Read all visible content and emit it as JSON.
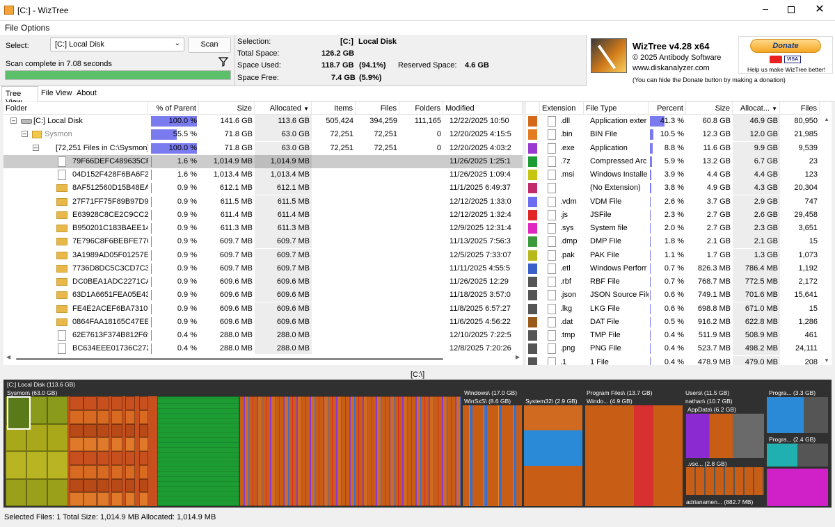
{
  "window": {
    "title": "[C:]  - WizTree"
  },
  "menu": {
    "file": "File",
    "options": "Options"
  },
  "select": {
    "label": "Select:",
    "value": "[C:] Local Disk",
    "scan_label": "Scan",
    "status": "Scan complete in 7.08 seconds",
    "progress": 1.0
  },
  "info": {
    "selection_label": "Selection:",
    "selection_drive": "[C:]",
    "selection_name": "Local Disk",
    "total_label": "Total Space:",
    "total_value": "126.2 GB",
    "used_label": "Space Used:",
    "used_value": "118.7 GB",
    "used_pct": "(94.1%)",
    "reserved_label": "Reserved Space:",
    "reserved_value": "4.6 GB",
    "free_label": "Space Free:",
    "free_value": "7.4 GB",
    "free_pct": "(5.9%)"
  },
  "about": {
    "title": "WizTree v4.28 x64",
    "copyright": "© 2025 Antibody Software",
    "site": "www.diskanalyzer.com",
    "note": "(You can hide the Donate button by making a donation)",
    "donate": "Donate",
    "help": "Help us make WizTree better!",
    "cards": "VISA"
  },
  "tabs": {
    "tree": "Tree View",
    "file": "File View",
    "about": "About"
  },
  "tree_headers": {
    "folder": "Folder",
    "pct": "% of Parent",
    "size": "Size",
    "alloc": "Allocated",
    "items": "Items",
    "files": "Files",
    "folders": "Folders",
    "modified": "Modified"
  },
  "tree_rows": [
    {
      "name": "[C:] Local Disk",
      "pct": "100.0 %",
      "pctv": 1.0,
      "size": "141.6 GB",
      "alloc": "113.6 GB",
      "items": "505,424",
      "files": "394,259",
      "folders": "111,165",
      "modified": "12/22/2025 10:50"
    },
    {
      "name": "Sysmon",
      "pct": "55.5 %",
      "pctv": 0.555,
      "size": "71.8 GB",
      "alloc": "63.0 GB",
      "items": "72,251",
      "files": "72,251",
      "folders": "0",
      "modified": "12/20/2025 4:15:5"
    },
    {
      "name": "[72,251 Files in C:\\Sysmon]",
      "pct": "100.0 %",
      "pctv": 1.0,
      "size": "71.8 GB",
      "alloc": "63.0 GB",
      "items": "72,251",
      "files": "72,251",
      "folders": "0",
      "modified": "12/20/2025 4:03:2"
    },
    {
      "name": "79F66DEFC489635CF5",
      "pct": "1.6 %",
      "pctv": 0.016,
      "size": "1,014.9 MB",
      "alloc": "1,014.9 MB",
      "items": "",
      "files": "",
      "folders": "",
      "modified": "11/26/2025 1:25:1"
    },
    {
      "name": "04D152F428F6BA6F23",
      "pct": "1.6 %",
      "pctv": 0.016,
      "size": "1,013.4 MB",
      "alloc": "1,013.4 MB",
      "items": "",
      "files": "",
      "folders": "",
      "modified": "11/26/2025 1:09:4"
    },
    {
      "name": "8AF512560D15B48EA",
      "pct": "0.9 %",
      "pctv": 0.009,
      "size": "612.1 MB",
      "alloc": "612.1 MB",
      "items": "",
      "files": "",
      "folders": "",
      "modified": "11/1/2025 6:49:37"
    },
    {
      "name": "27F71FF75F89B97D97",
      "pct": "0.9 %",
      "pctv": 0.009,
      "size": "611.5 MB",
      "alloc": "611.5 MB",
      "items": "",
      "files": "",
      "folders": "",
      "modified": "12/12/2025 1:33:0"
    },
    {
      "name": "E63928C8CE2C9CC21I",
      "pct": "0.9 %",
      "pctv": 0.009,
      "size": "611.4 MB",
      "alloc": "611.4 MB",
      "items": "",
      "files": "",
      "folders": "",
      "modified": "12/12/2025 1:32:4"
    },
    {
      "name": "B950201C183BAEE147",
      "pct": "0.9 %",
      "pctv": 0.009,
      "size": "611.3 MB",
      "alloc": "611.3 MB",
      "items": "",
      "files": "",
      "folders": "",
      "modified": "12/9/2025 12:31:4"
    },
    {
      "name": "7E796C8F6BEBFE776B",
      "pct": "0.9 %",
      "pctv": 0.009,
      "size": "609.7 MB",
      "alloc": "609.7 MB",
      "items": "",
      "files": "",
      "folders": "",
      "modified": "11/13/2025 7:56:3"
    },
    {
      "name": "3A1989AD05F01257E",
      "pct": "0.9 %",
      "pctv": 0.009,
      "size": "609.7 MB",
      "alloc": "609.7 MB",
      "items": "",
      "files": "",
      "folders": "",
      "modified": "12/5/2025 7:33:07"
    },
    {
      "name": "7736D8DC5C3CD7C3!",
      "pct": "0.9 %",
      "pctv": 0.009,
      "size": "609.7 MB",
      "alloc": "609.7 MB",
      "items": "",
      "files": "",
      "folders": "",
      "modified": "11/11/2025 4:55:5"
    },
    {
      "name": "DC0BEA1ADC2271CA",
      "pct": "0.9 %",
      "pctv": 0.009,
      "size": "609.6 MB",
      "alloc": "609.6 MB",
      "items": "",
      "files": "",
      "folders": "",
      "modified": "11/26/2025 12:29"
    },
    {
      "name": "63D1A6651FEA05E43",
      "pct": "0.9 %",
      "pctv": 0.009,
      "size": "609.6 MB",
      "alloc": "609.6 MB",
      "items": "",
      "files": "",
      "folders": "",
      "modified": "11/18/2025 3:57:0"
    },
    {
      "name": "FE4E2ACEF6BA73109",
      "pct": "0.9 %",
      "pctv": 0.009,
      "size": "609.6 MB",
      "alloc": "609.6 MB",
      "items": "",
      "files": "",
      "folders": "",
      "modified": "11/8/2025 6:57:27"
    },
    {
      "name": "0864FAA18165C47EE",
      "pct": "0.9 %",
      "pctv": 0.009,
      "size": "609.6 MB",
      "alloc": "609.6 MB",
      "items": "",
      "files": "",
      "folders": "",
      "modified": "11/6/2025 4:56:22"
    },
    {
      "name": "62E7613F374B812F69",
      "pct": "0.4 %",
      "pctv": 0.004,
      "size": "288.0 MB",
      "alloc": "288.0 MB",
      "items": "",
      "files": "",
      "folders": "",
      "modified": "12/10/2025 7:22:5"
    },
    {
      "name": "BC634EEE01736C2728",
      "pct": "0.4 %",
      "pctv": 0.004,
      "size": "288.0 MB",
      "alloc": "288.0 MB",
      "items": "",
      "files": "",
      "folders": "",
      "modified": "12/8/2025 7:20:26"
    }
  ],
  "ext_headers": {
    "ext": "Extension",
    "type": "File Type",
    "pct": "Percent",
    "size": "Size",
    "alloc": "Allocat...",
    "files": "Files"
  },
  "ext_rows": [
    {
      "color": "#d4691a",
      "ext": ".dll",
      "type": "Application exter",
      "pct": "41.3 %",
      "pctv": 0.413,
      "size": "60.8 GB",
      "alloc": "46.9 GB",
      "files": "80,950"
    },
    {
      "color": "#e37b22",
      "ext": ".bin",
      "type": "BIN File",
      "pct": "10.5 %",
      "pctv": 0.105,
      "size": "12.3 GB",
      "alloc": "12.0 GB",
      "files": "21,985"
    },
    {
      "color": "#9a39d0",
      "ext": ".exe",
      "type": "Application",
      "pct": "8.8 %",
      "pctv": 0.088,
      "size": "11.6 GB",
      "alloc": "9.9 GB",
      "files": "9,539"
    },
    {
      "color": "#1e9c34",
      "ext": ".7z",
      "type": "Compressed Arc",
      "pct": "5.9 %",
      "pctv": 0.059,
      "size": "13.2 GB",
      "alloc": "6.7 GB",
      "files": "23"
    },
    {
      "color": "#c6c612",
      "ext": ".msi",
      "type": "Windows Installe",
      "pct": "3.9 %",
      "pctv": 0.039,
      "size": "4.4 GB",
      "alloc": "4.4 GB",
      "files": "123"
    },
    {
      "color": "#c22a6a",
      "ext": "",
      "type": "(No Extension)",
      "pct": "3.8 %",
      "pctv": 0.038,
      "size": "4.9 GB",
      "alloc": "4.3 GB",
      "files": "20,304"
    },
    {
      "color": "#6d6df2",
      "ext": ".vdm",
      "type": "VDM File",
      "pct": "2.6 %",
      "pctv": 0.026,
      "size": "3.7 GB",
      "alloc": "2.9 GB",
      "files": "747"
    },
    {
      "color": "#e02626",
      "ext": ".js",
      "type": "JSFile",
      "pct": "2.3 %",
      "pctv": 0.023,
      "size": "2.7 GB",
      "alloc": "2.6 GB",
      "files": "29,458"
    },
    {
      "color": "#e028c0",
      "ext": ".sys",
      "type": "System file",
      "pct": "2.0 %",
      "pctv": 0.02,
      "size": "2.7 GB",
      "alloc": "2.3 GB",
      "files": "3,651"
    },
    {
      "color": "#3c9a3c",
      "ext": ".dmp",
      "type": "DMP File",
      "pct": "1.8 %",
      "pctv": 0.018,
      "size": "2.1 GB",
      "alloc": "2.1 GB",
      "files": "15"
    },
    {
      "color": "#b8b81c",
      "ext": ".pak",
      "type": "PAK File",
      "pct": "1.1 %",
      "pctv": 0.011,
      "size": "1.7 GB",
      "alloc": "1.3 GB",
      "files": "1,073"
    },
    {
      "color": "#3a5fc8",
      "ext": ".etl",
      "type": "Windows Perforr",
      "pct": "0.7 %",
      "pctv": 0.007,
      "size": "826.3 MB",
      "alloc": "786.4 MB",
      "files": "1,192"
    },
    {
      "color": "#555555",
      "ext": ".rbf",
      "type": "RBF File",
      "pct": "0.7 %",
      "pctv": 0.007,
      "size": "768.7 MB",
      "alloc": "772.5 MB",
      "files": "2,172"
    },
    {
      "color": "#555555",
      "ext": ".json",
      "type": "JSON Source File",
      "pct": "0.6 %",
      "pctv": 0.006,
      "size": "749.1 MB",
      "alloc": "701.6 MB",
      "files": "15,641"
    },
    {
      "color": "#555555",
      "ext": ".lkg",
      "type": "LKG File",
      "pct": "0.6 %",
      "pctv": 0.006,
      "size": "698.8 MB",
      "alloc": "671.0 MB",
      "files": "15"
    },
    {
      "color": "#9a5a1a",
      "ext": ".dat",
      "type": "DAT File",
      "pct": "0.5 %",
      "pctv": 0.005,
      "size": "916.2 MB",
      "alloc": "622.8 MB",
      "files": "1,286"
    },
    {
      "color": "#555555",
      "ext": ".tmp",
      "type": "TMP File",
      "pct": "0.4 %",
      "pctv": 0.004,
      "size": "511.9 MB",
      "alloc": "508.9 MB",
      "files": "461"
    },
    {
      "color": "#555555",
      "ext": ".png",
      "type": "PNG File",
      "pct": "0.4 %",
      "pctv": 0.004,
      "size": "523.7 MB",
      "alloc": "498.2 MB",
      "files": "24,111"
    },
    {
      "color": "#555555",
      "ext": ".1",
      "type": "1 File",
      "pct": "0.4 %",
      "pctv": 0.004,
      "size": "478.9 MB",
      "alloc": "479.0 MB",
      "files": "208"
    }
  ],
  "treemap": {
    "path": "[C:\\]",
    "labels": {
      "root": "[C:] Local Disk (113.6 GB)",
      "sysmon": "Sysmon\\ (63.0 GB)",
      "windows": "Windows\\ (17.0 GB)",
      "winsxs": "WinSxS\\ (8.6 GB)",
      "system32": "System32\\ (2.9 GB)",
      "progfiles": "Program Files\\ (13.7 GB)",
      "windo": "Windo... (4.9 GB)",
      "users": "Users\\ (11.5 GB)",
      "nathan": "nathan\\ (10.7 GB)",
      "appdata": "AppData\\ (6.2 GB)",
      "vsc": ".vsc... (2.8 GB)",
      "adrian": "adrianamen... (882.7 MB)",
      "progra1": "Progra... (3.3 GB)",
      "progra2": "Progra... (2.4 GB)"
    }
  },
  "status": {
    "text": "Selected Files: 1  Total Size: 1,014.9 MB  Allocated: 1,014.9 MB"
  }
}
